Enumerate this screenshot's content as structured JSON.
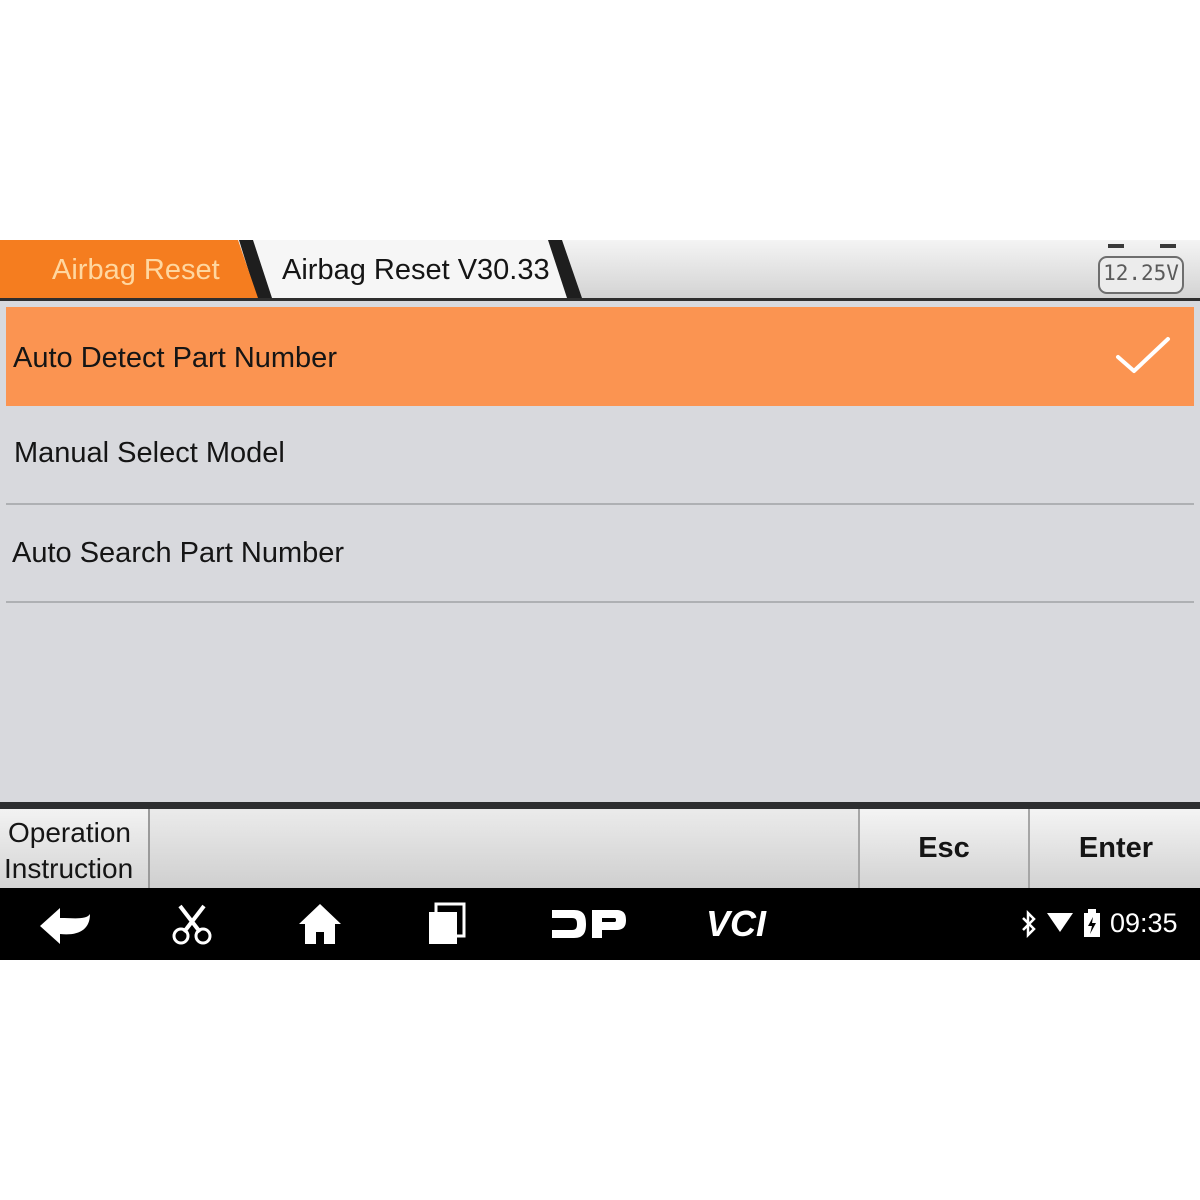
{
  "header": {
    "breadcrumb": [
      {
        "label": "Airbag Reset"
      },
      {
        "label": "Airbag Reset V30.33"
      }
    ],
    "voltage": "12.25V"
  },
  "list": {
    "items": [
      {
        "label": "Auto Detect Part Number",
        "selected": true
      },
      {
        "label": "Manual Select Model",
        "selected": false
      },
      {
        "label": "Auto Search Part Number",
        "selected": false
      }
    ]
  },
  "toolbar": {
    "operation_line1": "Operation",
    "operation_line2": "Instruction",
    "esc_label": "Esc",
    "enter_label": "Enter"
  },
  "navbar": {
    "icons": [
      "back-icon",
      "scissors-icon",
      "home-icon",
      "recent-apps-icon",
      "dp-icon",
      "vci-icon"
    ],
    "dp_text": "DP",
    "vci_text": "VCI",
    "status_icons": [
      "bluetooth-icon",
      "wifi-icon",
      "battery-icon"
    ],
    "time": "09:35"
  },
  "colors": {
    "accent": "#fb9451",
    "breadcrumb_active": "#f57d1f",
    "background": "#d8d9dd",
    "navbar": "#000000"
  }
}
